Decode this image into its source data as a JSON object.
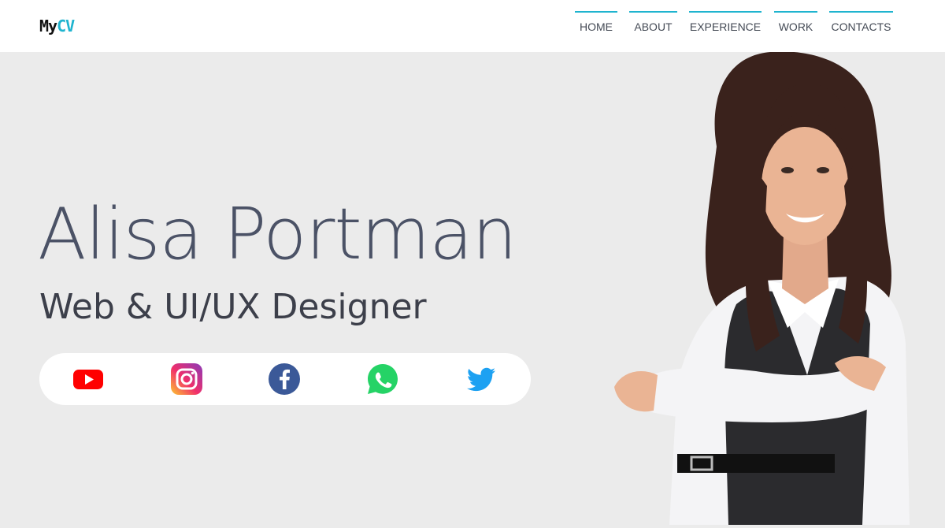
{
  "header": {
    "logo": {
      "part1": "My",
      "part2": "CV"
    },
    "nav": [
      {
        "label": "HOME"
      },
      {
        "label": "ABOUT"
      },
      {
        "label": "EXPERIENCE"
      },
      {
        "label": "WORK"
      },
      {
        "label": "CONTACTS"
      }
    ]
  },
  "hero": {
    "name": "Alisa Portman",
    "role": "Web & UI/UX Designer"
  },
  "social": [
    {
      "icon": "youtube-icon",
      "color": "#ff0000"
    },
    {
      "icon": "instagram-icon",
      "color": "#e1306c"
    },
    {
      "icon": "facebook-icon",
      "color": "#3b5998"
    },
    {
      "icon": "whatsapp-icon",
      "color": "#25d366"
    },
    {
      "icon": "twitter-icon",
      "color": "#1da1f2"
    }
  ],
  "colors": {
    "accent": "#1fb4cf",
    "background": "#ebebeb",
    "name_text": "#4b5266"
  }
}
